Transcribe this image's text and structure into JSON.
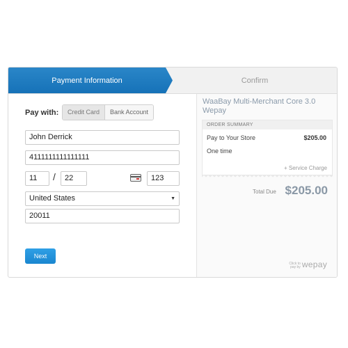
{
  "steps": {
    "active": "Payment Information",
    "inactive": "Confirm"
  },
  "form": {
    "pay_with_label": "Pay with:",
    "methods": [
      "Credit Card",
      "Bank Account"
    ],
    "selected_method": "Credit Card",
    "name": "John Derrick",
    "card_number": "4111111111111111",
    "exp_month": "11",
    "exp_separator": "/",
    "exp_year": "22",
    "cvv": "123",
    "country": "United States",
    "zip": "20011",
    "next_label": "Next"
  },
  "summary": {
    "merchant": "WaaBay Multi-Merchant Core 3.0 Wepay",
    "header": "ORDER SUMMARY",
    "item": "Pay to Your Store",
    "item_amount": "$205.00",
    "frequency": "One time",
    "service_charge": "+ Service Charge",
    "total_label": "Total Due",
    "total_amount": "$205.00"
  },
  "branding": {
    "powered_small": "Click to pay by",
    "logo": "wepay"
  },
  "icons": {
    "card": "credit-card-icon",
    "dropdown": "chevron-down-icon"
  },
  "colors": {
    "accent": "#1a7ac0",
    "button": "#1d8ad4",
    "total": "#8a98a6"
  }
}
